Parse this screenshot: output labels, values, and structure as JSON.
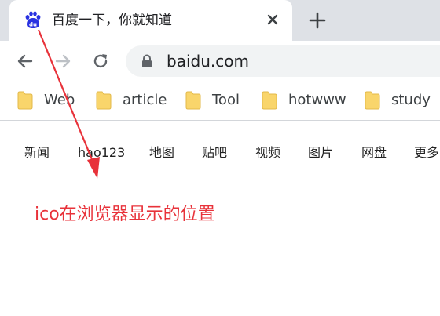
{
  "tab": {
    "title": "百度一下，你就知道",
    "favicon": "baidu-paw-icon"
  },
  "toolbar": {
    "url": "baidu.com"
  },
  "bookmarks": [
    {
      "label": "Web"
    },
    {
      "label": "article"
    },
    {
      "label": "Tool"
    },
    {
      "label": "hotwww"
    },
    {
      "label": "study"
    }
  ],
  "baidu_nav": [
    "新闻",
    "hao123",
    "地图",
    "贴吧",
    "视频",
    "图片",
    "网盘",
    "更多"
  ],
  "annotation": {
    "text": "ico在浏览器显示的位置",
    "color": "#e8323a"
  },
  "colors": {
    "tabstrip": "#dee1e6",
    "omnibox": "#f1f3f4",
    "folder": "#f9d56b",
    "favicon": "#2932e1"
  }
}
